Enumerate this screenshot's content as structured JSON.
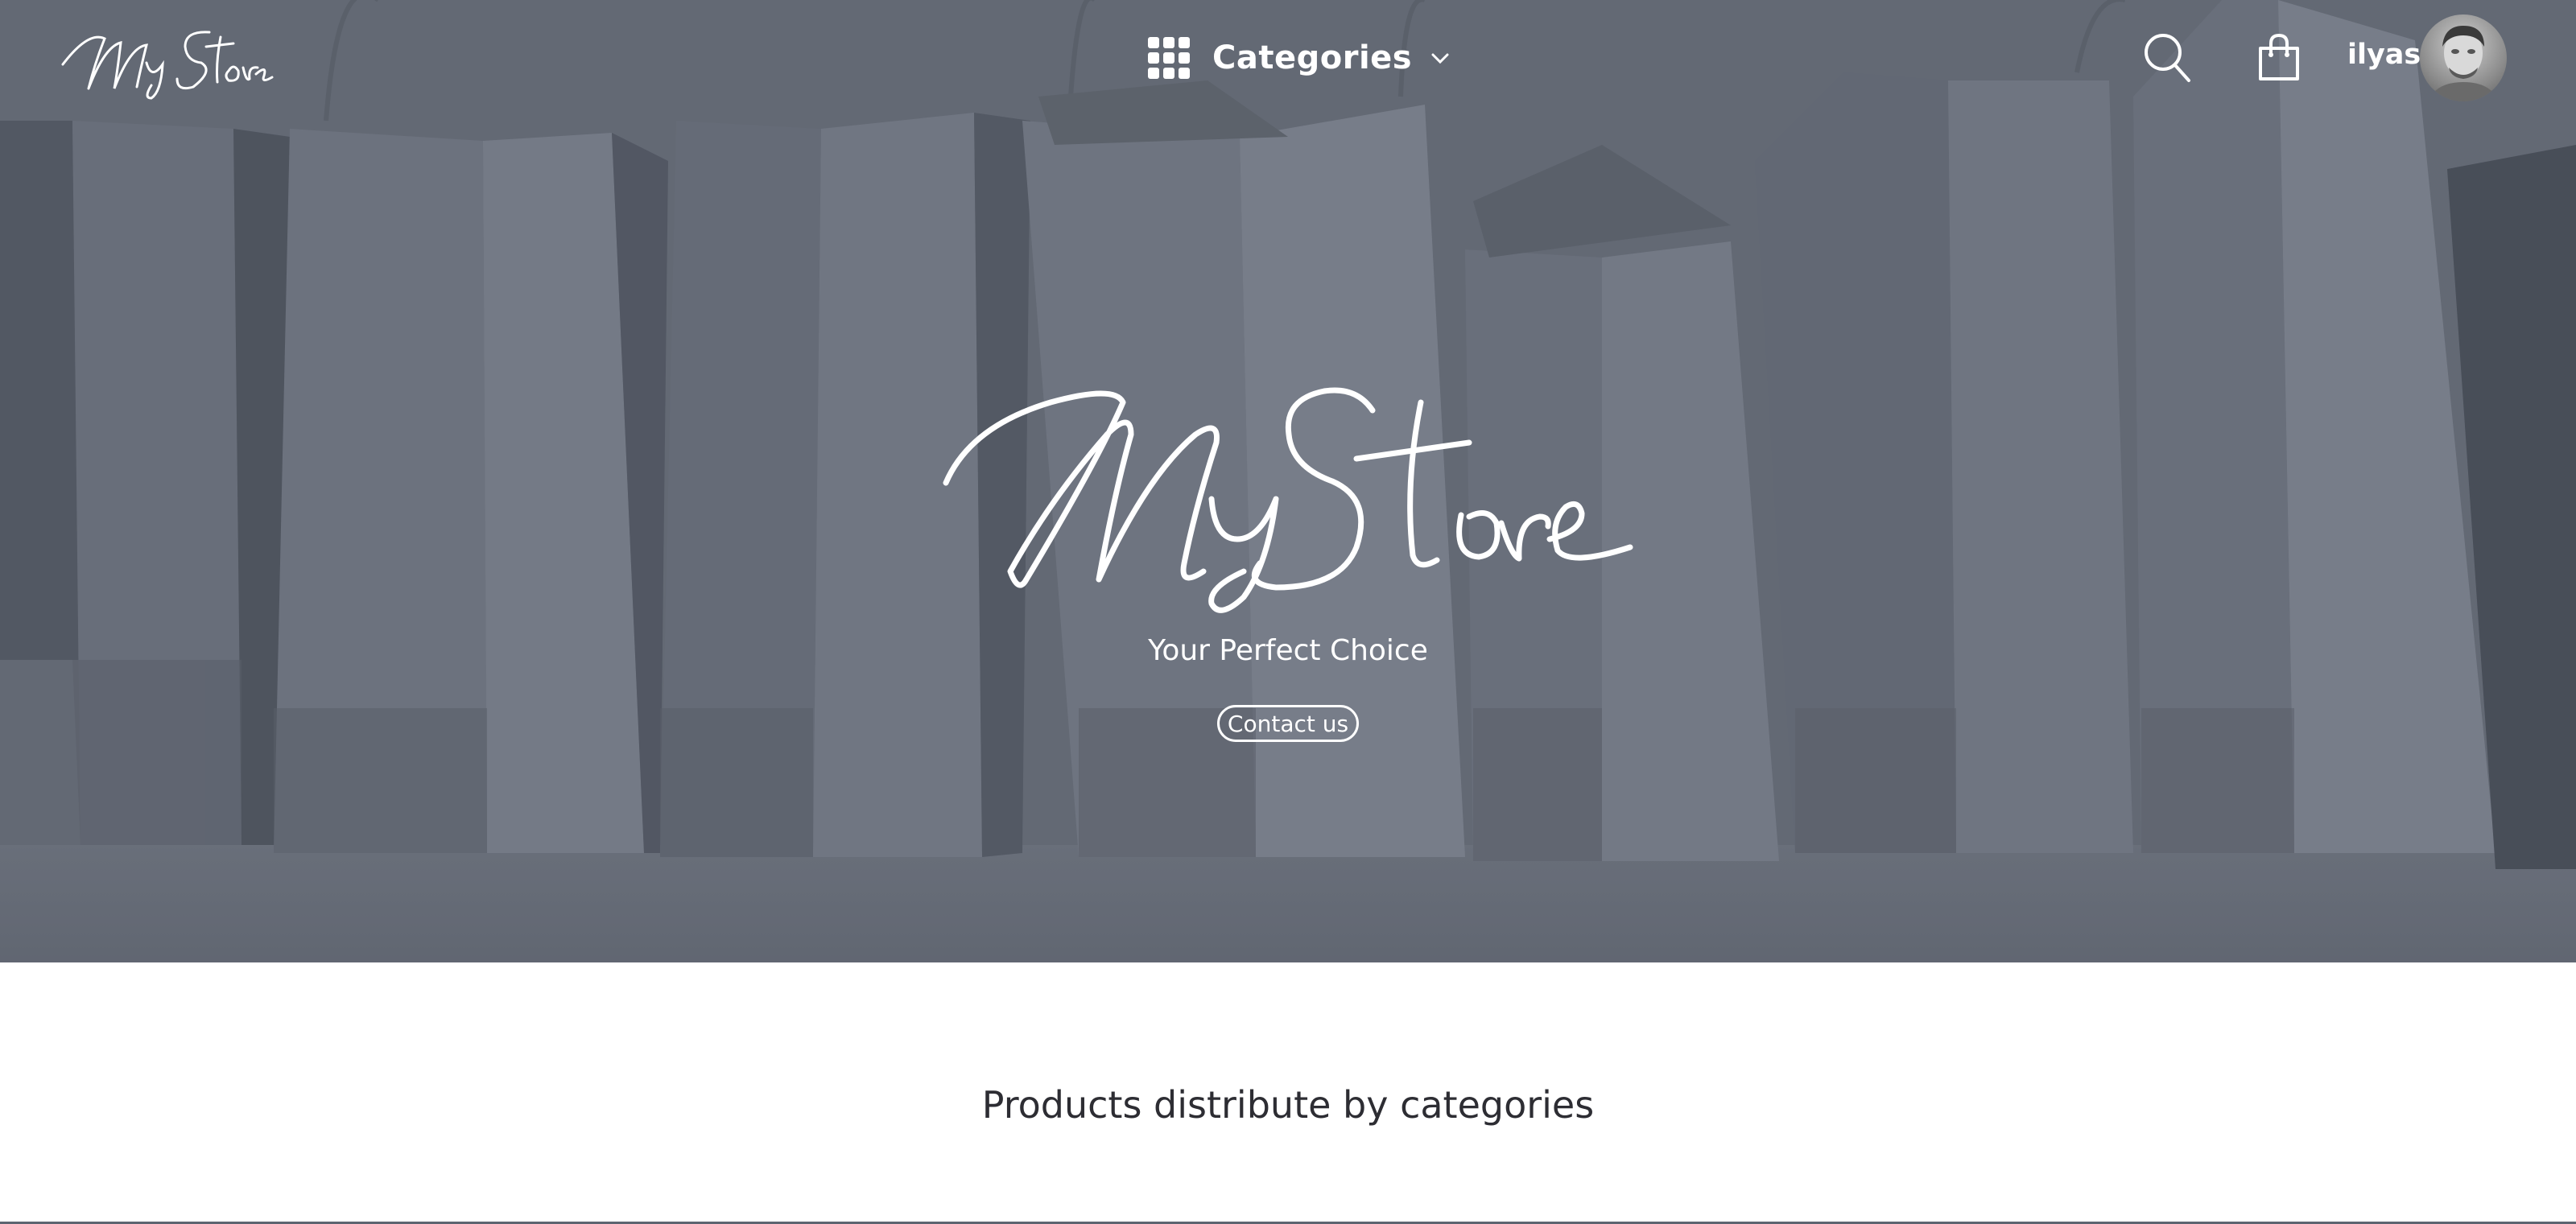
{
  "brand": {
    "logo_text": "MyStore"
  },
  "nav": {
    "categories_label": "Categories",
    "user_name": "ilyas"
  },
  "hero": {
    "logo_text": "MyStore",
    "tagline": "Your Perfect Choice",
    "contact_label": "Contact us"
  },
  "main": {
    "section_title": "Products distribute by categories"
  },
  "icons": {
    "categories": "grid-icon",
    "dropdown": "chevron-down-icon",
    "search": "search-icon",
    "cart": "shopping-bag-icon",
    "avatar": "user-avatar"
  },
  "colors": {
    "hero_overlay": "#6b707b",
    "text_on_hero": "#ffffff",
    "section_title": "#2d2d33"
  }
}
